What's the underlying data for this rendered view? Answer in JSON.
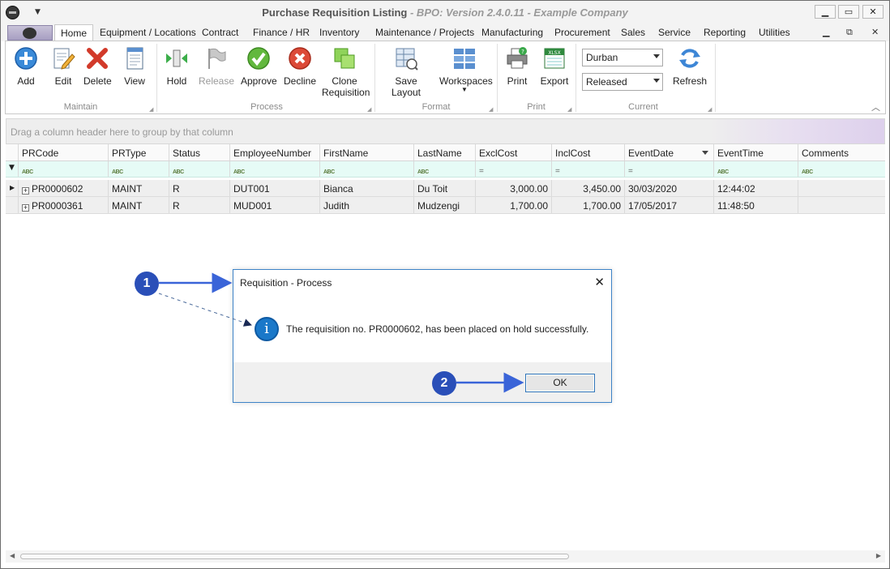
{
  "window": {
    "title": "Purchase Requisition Listing",
    "version": " - BPO: Version 2.4.0.11 - Example Company"
  },
  "tabs": [
    "Home",
    "Equipment / Locations",
    "Contract",
    "Finance / HR",
    "Inventory",
    "Maintenance / Projects",
    "Manufacturing",
    "Procurement",
    "Sales",
    "Service",
    "Reporting",
    "Utilities"
  ],
  "ribbon": {
    "maintain": {
      "label": "Maintain",
      "add": "Add",
      "edit": "Edit",
      "delete": "Delete",
      "view": "View"
    },
    "process": {
      "label": "Process",
      "hold": "Hold",
      "release": "Release",
      "approve": "Approve",
      "decline": "Decline",
      "clone_line1": "Clone",
      "clone_line2": "Requisition"
    },
    "format": {
      "label": "Format",
      "save_layout": "Save Layout",
      "workspaces": "Workspaces"
    },
    "print": {
      "label": "Print",
      "print": "Print",
      "export": "Export",
      "xlsx": "XLSX"
    },
    "current": {
      "label": "Current",
      "site": "Durban",
      "status": "Released",
      "refresh": "Refresh"
    }
  },
  "grid": {
    "group_hint": "Drag a column header here to group by that column",
    "columns": [
      "PRCode",
      "PRType",
      "Status",
      "EmployeeNumber",
      "FirstName",
      "LastName",
      "ExclCost",
      "InclCost",
      "EventDate",
      "EventTime",
      "Comments"
    ],
    "filter_abc": "ABC",
    "filter_eq": "=",
    "rows": [
      [
        "PR0000602",
        "MAINT",
        "R",
        "DUT001",
        "Bianca",
        "Du Toit",
        "3,000.00",
        "3,450.00",
        "30/03/2020",
        "12:44:02",
        ""
      ],
      [
        "PR0000361",
        "MAINT",
        "R",
        "MUD001",
        "Judith",
        "Mudzengi",
        "1,700.00",
        "1,700.00",
        "17/05/2017",
        "11:48:50",
        ""
      ]
    ]
  },
  "dialog": {
    "title": "Requisition - Process",
    "message": "The requisition no. PR0000602, has been placed on hold successfully.",
    "ok": "OK",
    "info_glyph": "i"
  },
  "annotations": {
    "badge1": "1",
    "badge2": "2"
  },
  "colors": {
    "accent": "#2a4fb8",
    "dialog_border": "#3d83c7",
    "filter_row": "#e6fbf6"
  }
}
